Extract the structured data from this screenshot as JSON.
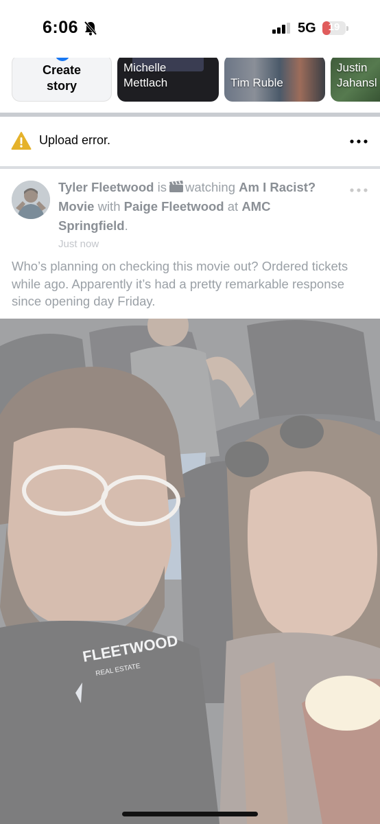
{
  "status_bar": {
    "time": "6:06",
    "network": "5G",
    "battery_level": "19",
    "battery_fraction": 0.19,
    "icons": [
      "bell-slash-icon",
      "signal-bars-icon",
      "battery-icon"
    ]
  },
  "stories": {
    "create_label": "Create story",
    "items": [
      {
        "name": "Michelle Mettlach"
      },
      {
        "name": "Tim Ruble"
      },
      {
        "name": "Justin Jahansl"
      }
    ]
  },
  "upload_error": {
    "text": "Upload error.",
    "icons": [
      "warning-icon",
      "more-options-icon"
    ]
  },
  "post": {
    "author": "Tyler Fleetwood",
    "verb": "is",
    "activity_icon": "clapperboard-icon",
    "activity": "watching",
    "movie": "Am I Racist? Movie",
    "with_word": "with",
    "tagged": "Paige Fleetwood",
    "at_word": "at",
    "place": "AMC Springfield",
    "end_punct": ".",
    "time": "Just now",
    "body": "Who’s planning on checking this movie out? Ordered tickets while ago. Apparently it’s had a pretty remarkable response since opening day Friday.",
    "photo_shirt_text": "FLEETWOOD",
    "photo_shirt_subtext": "REAL ESTATE"
  },
  "colors": {
    "accent": "#1877f2",
    "warning": "#e5b22b",
    "battery_low": "#e05c5c",
    "muted_text": "#9aa0a6"
  }
}
